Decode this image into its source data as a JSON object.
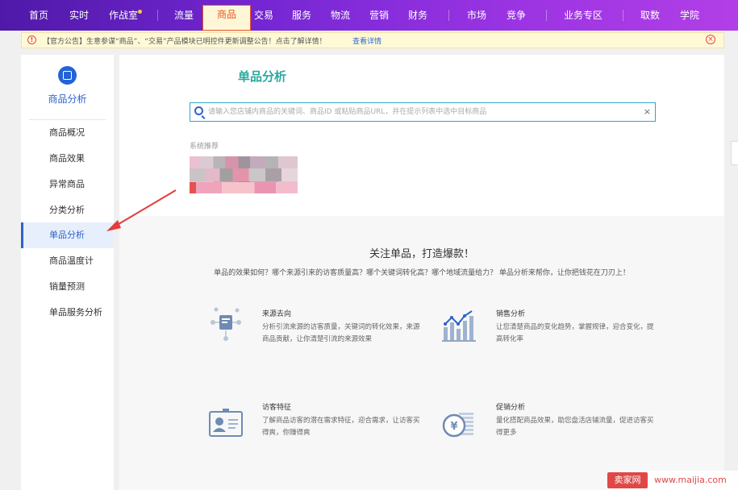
{
  "nav": {
    "items": [
      "首页",
      "实时",
      "作战室",
      "流量",
      "商品",
      "交易",
      "服务",
      "物流",
      "营销",
      "财务",
      "市场",
      "竞争",
      "业务专区",
      "取数",
      "学院"
    ],
    "active": "商品"
  },
  "notice": {
    "text": "【官方公告】生意参谋“商品”、“交易”产品模块已明控件更新调整公告！点击了解详情！",
    "link": "查看详情"
  },
  "sidebar": {
    "title": "商品分析",
    "items": [
      {
        "label": "商品概况"
      },
      {
        "label": "商品效果"
      },
      {
        "label": "异常商品"
      },
      {
        "label": "分类分析"
      },
      {
        "label": "单品分析"
      },
      {
        "label": "商品温度计"
      },
      {
        "label": "销量预测"
      },
      {
        "label": "单品服务分析"
      }
    ],
    "active": "单品分析"
  },
  "main": {
    "title": "单品分析",
    "search_placeholder": "请输入您店铺内商品的关键词、商品ID 或粘贴商品URL，并在提示列表中选中目标商品",
    "recommend_label": "系统推荐"
  },
  "promo": {
    "title": "关注单品，打造爆款！",
    "subtitle": "单品的效果如何？哪个来源引来的访客质量高？哪个关键词转化高？哪个地域流量给力？ 单品分析来帮你，让你把钱花在刀刃上！",
    "features": [
      {
        "icon": "source-icon",
        "title": "来源去向",
        "desc": "分析引流来源的访客质量，关键词的转化效果，来源商品贡献，让你清楚引流的来源效果"
      },
      {
        "icon": "sales-chart-icon",
        "title": "销售分析",
        "desc": "让您清楚商品的变化趋势，掌握规律，迎合变化，提高转化率"
      },
      {
        "icon": "visitor-card-icon",
        "title": "访客特征",
        "desc": "了解商品访客的潜在需求特征，迎合需求，让访客买得爽，你赚得爽"
      },
      {
        "icon": "promotion-coin-icon",
        "title": "促销分析",
        "desc": "量化搭配商品效果，助您盘活店铺流量，促进访客买得更多"
      }
    ]
  },
  "watermark": {
    "badge": "卖家网",
    "url": "www.maijia.com"
  },
  "colors": {
    "nav_gradient_start": "#4f19a8",
    "nav_gradient_end": "#b23fe6",
    "accent_blue": "#2e63c9",
    "title_teal": "#2aa8a0",
    "arrow_red": "#e43b3b"
  }
}
